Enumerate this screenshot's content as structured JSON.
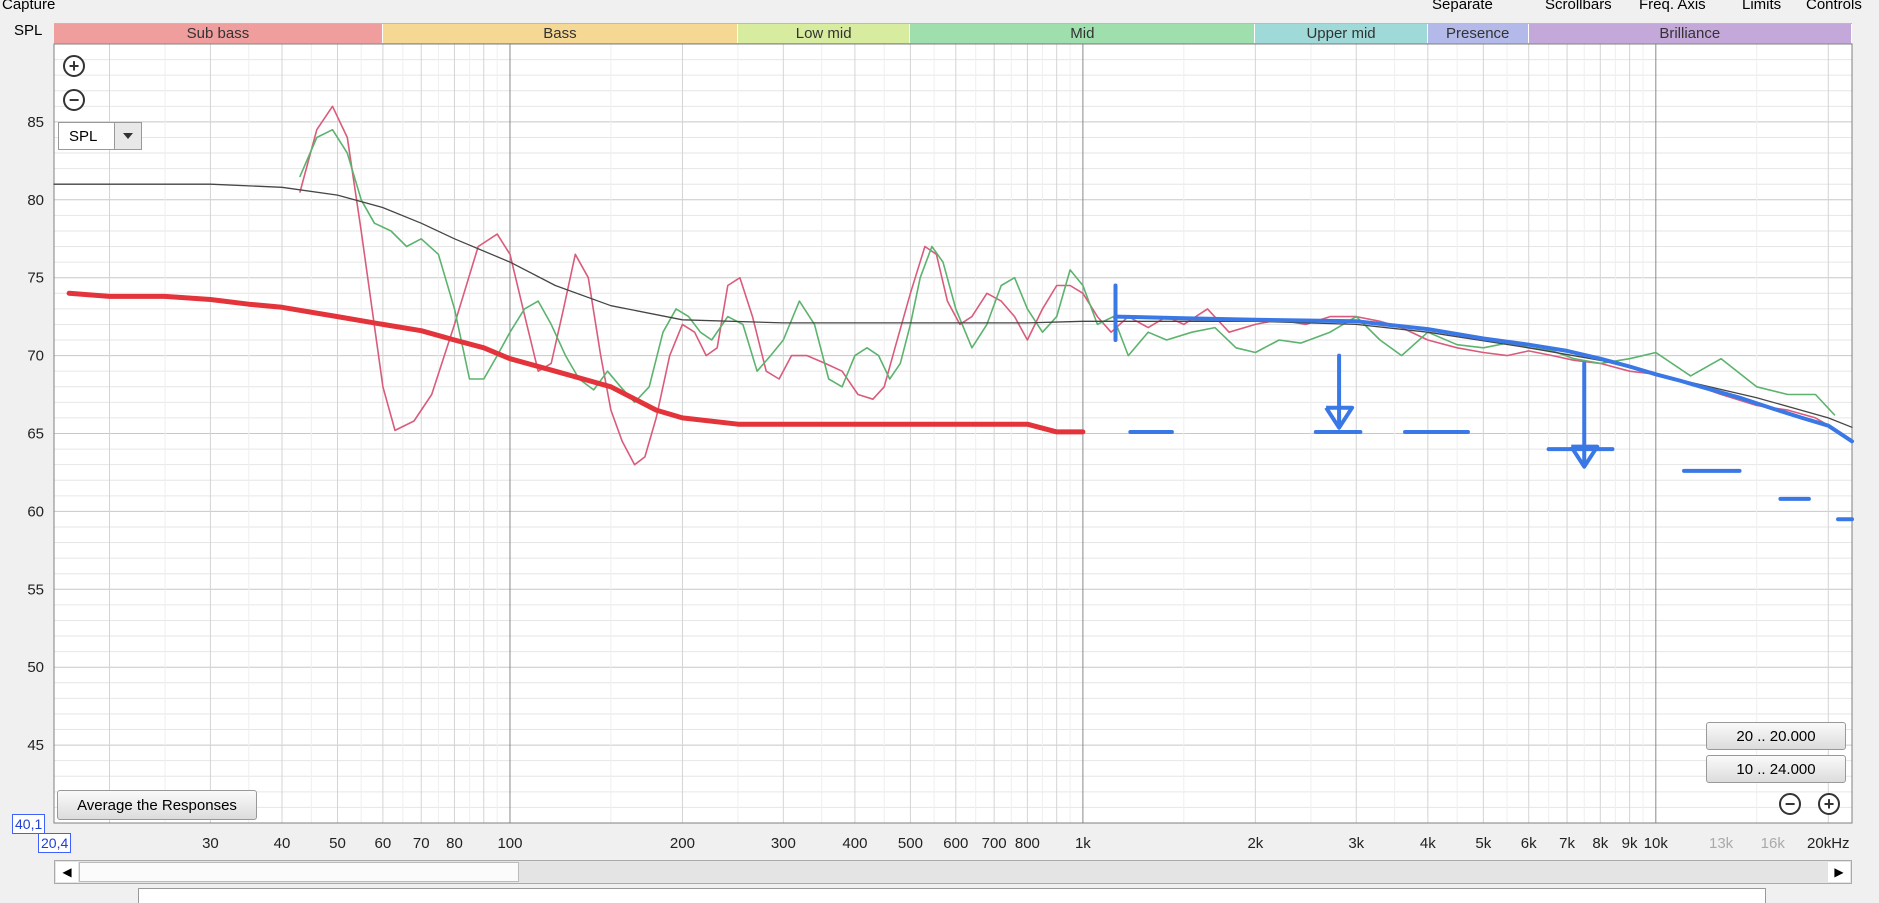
{
  "header": {
    "capture_label": "Capture",
    "spl_corner_label": "SPL",
    "menu": [
      "Separate",
      "Scrollbars",
      "Freq. Axis",
      "Limits",
      "Controls"
    ]
  },
  "bands": [
    {
      "label": "Sub bass",
      "from": 16,
      "to": 60,
      "color": "#ef9d9d"
    },
    {
      "label": "Bass",
      "from": 60,
      "to": 250,
      "color": "#f5d894"
    },
    {
      "label": "Low mid",
      "from": 250,
      "to": 500,
      "color": "#d8ec9f"
    },
    {
      "label": "Mid",
      "from": 500,
      "to": 2000,
      "color": "#9fdfae"
    },
    {
      "label": "Upper mid",
      "from": 2000,
      "to": 4000,
      "color": "#9fdad9"
    },
    {
      "label": "Presence",
      "from": 4000,
      "to": 6000,
      "color": "#b3b9e8"
    },
    {
      "label": "Brilliance",
      "from": 6000,
      "to": 22000,
      "color": "#c5a8da"
    }
  ],
  "controls": {
    "spl_select_value": "SPL",
    "average_button": "Average the Responses",
    "range_button_1": "20 .. 20.000",
    "range_button_2": "10 .. 24.000",
    "coord_y": "40,1",
    "coord_x": "20,4"
  },
  "chart_data": {
    "type": "line",
    "xscale": "log",
    "xlim": [
      16,
      22000
    ],
    "ylim": [
      40,
      90
    ],
    "ylabel": "SPL",
    "xunit": "kHz",
    "yticks": [
      45,
      50,
      55,
      60,
      65,
      70,
      75,
      80,
      85
    ],
    "xticks": [
      {
        "f": 30,
        "label": "30"
      },
      {
        "f": 40,
        "label": "40"
      },
      {
        "f": 50,
        "label": "50"
      },
      {
        "f": 60,
        "label": "60"
      },
      {
        "f": 70,
        "label": "70"
      },
      {
        "f": 80,
        "label": "80"
      },
      {
        "f": 100,
        "label": "100"
      },
      {
        "f": 200,
        "label": "200"
      },
      {
        "f": 300,
        "label": "300"
      },
      {
        "f": 400,
        "label": "400"
      },
      {
        "f": 500,
        "label": "500"
      },
      {
        "f": 600,
        "label": "600"
      },
      {
        "f": 700,
        "label": "700"
      },
      {
        "f": 800,
        "label": "800"
      },
      {
        "f": 1000,
        "label": "1k"
      },
      {
        "f": 2000,
        "label": "2k"
      },
      {
        "f": 3000,
        "label": "3k"
      },
      {
        "f": 4000,
        "label": "4k"
      },
      {
        "f": 5000,
        "label": "5k"
      },
      {
        "f": 6000,
        "label": "6k"
      },
      {
        "f": 7000,
        "label": "7k"
      },
      {
        "f": 8000,
        "label": "8k"
      },
      {
        "f": 9000,
        "label": "9k"
      },
      {
        "f": 10000,
        "label": "10k"
      },
      {
        "f": 13000,
        "label": "13k",
        "dim": true
      },
      {
        "f": 16000,
        "label": "16k",
        "dim": true
      },
      {
        "f": 20000,
        "label": "20kHz"
      }
    ],
    "series": [
      {
        "color": "#d95c7c",
        "x": [
          43,
          46,
          49,
          52,
          55,
          60,
          63,
          68,
          73,
          80,
          88,
          95,
          100,
          107,
          112,
          118,
          124,
          130,
          137,
          144,
          150,
          157,
          165,
          172,
          180,
          190,
          200,
          210,
          220,
          230,
          240,
          252,
          265,
          280,
          295,
          310,
          330,
          355,
          380,
          405,
          430,
          450,
          470,
          500,
          530,
          555,
          580,
          610,
          640,
          680,
          720,
          760,
          800,
          850,
          900,
          950,
          1000,
          1060,
          1120,
          1200,
          1300,
          1400,
          1500,
          1650,
          1800,
          2000,
          2200,
          2450,
          2700,
          3000,
          3300,
          3600,
          4000,
          4500,
          5000,
          5500,
          6000,
          6600,
          7200,
          8000,
          9000,
          10000,
          11500,
          13000,
          15000,
          17000,
          19000,
          20500
        ],
        "y": [
          80.5,
          84.5,
          86,
          84,
          78,
          68,
          65.2,
          65.8,
          67.5,
          72,
          77,
          77.8,
          76.5,
          72,
          69,
          69.5,
          73,
          76.5,
          75,
          70,
          66.5,
          64.5,
          63,
          63.5,
          66,
          70,
          72,
          71.5,
          70,
          70.5,
          74.5,
          75,
          72.5,
          69,
          68.5,
          70,
          70,
          69.5,
          69,
          67.5,
          67.2,
          68,
          70.5,
          74,
          77,
          76.5,
          73.5,
          72,
          72.5,
          74,
          73.5,
          72.5,
          71,
          73,
          74.5,
          74.5,
          74,
          72.5,
          71.5,
          72.5,
          71.8,
          72.5,
          72,
          73,
          71.5,
          72,
          72.3,
          72,
          72.5,
          72.5,
          72.2,
          71.8,
          71,
          70.5,
          70.2,
          70,
          70.3,
          70,
          69.7,
          69.5,
          69,
          68.8,
          68.2,
          67.5,
          66.8,
          66.5,
          66,
          65.3
        ]
      },
      {
        "color": "#5cb36e",
        "x": [
          43,
          46,
          49,
          52,
          55,
          58,
          62,
          66,
          70,
          75,
          80,
          85,
          90,
          95,
          100,
          106,
          112,
          118,
          125,
          132,
          140,
          148,
          156,
          165,
          175,
          185,
          195,
          205,
          215,
          225,
          240,
          255,
          270,
          285,
          300,
          320,
          340,
          360,
          380,
          400,
          420,
          440,
          460,
          480,
          500,
          520,
          545,
          570,
          600,
          640,
          680,
          720,
          760,
          800,
          850,
          900,
          950,
          1000,
          1060,
          1130,
          1200,
          1300,
          1400,
          1550,
          1700,
          1850,
          2000,
          2200,
          2400,
          2700,
          3000,
          3300,
          3600,
          4000,
          4500,
          5000,
          5500,
          6000,
          6600,
          7200,
          8000,
          9000,
          10000,
          11500,
          13000,
          15000,
          17000,
          19000,
          20500
        ],
        "y": [
          81.5,
          84,
          84.5,
          83,
          80,
          78.5,
          78,
          77,
          77.5,
          76.5,
          73,
          68.5,
          68.5,
          70,
          71.5,
          73,
          73.5,
          72,
          70,
          68.5,
          67.8,
          69,
          68,
          67,
          68,
          71.5,
          73,
          72.5,
          71.5,
          71,
          72.5,
          72,
          69,
          70,
          71,
          73.5,
          72,
          68.5,
          68,
          70,
          70.5,
          70,
          68.5,
          69.5,
          72,
          75,
          77,
          76,
          73,
          70.5,
          72,
          74.5,
          75,
          73,
          71.5,
          72.5,
          75.5,
          74.5,
          72,
          72.5,
          70,
          71.5,
          71,
          71.5,
          71.8,
          70.5,
          70.2,
          71,
          70.8,
          71.5,
          72.5,
          71,
          70,
          71.5,
          70.7,
          70.5,
          70.8,
          70.5,
          70.3,
          69.8,
          69.5,
          69.8,
          70.2,
          68.7,
          69.8,
          68,
          67.5,
          67.5,
          66.2
        ]
      },
      {
        "color": "#454545",
        "x": [
          16,
          30,
          40,
          50,
          60,
          70,
          80,
          100,
          120,
          150,
          200,
          300,
          500,
          800,
          1000,
          1500,
          2000,
          3000,
          4000,
          6000,
          8000,
          10000,
          15000,
          20000,
          22000
        ],
        "y": [
          81,
          81,
          80.8,
          80.3,
          79.5,
          78.5,
          77.5,
          76,
          74.5,
          73.2,
          72.3,
          72.1,
          72.1,
          72.1,
          72.2,
          72.2,
          72.2,
          72,
          71.5,
          70.5,
          69.7,
          68.8,
          67.3,
          66,
          65.4
        ]
      },
      {
        "color": "#e3343c",
        "x": [
          17,
          20,
          25,
          30,
          35,
          40,
          50,
          60,
          70,
          80,
          90,
          100,
          120,
          150,
          180,
          200,
          250,
          300,
          400,
          600,
          800,
          900,
          1000
        ],
        "y": [
          74,
          73.8,
          73.8,
          73.6,
          73.3,
          73.1,
          72.5,
          72,
          71.6,
          71,
          70.5,
          69.8,
          69,
          68,
          66.5,
          66,
          65.6,
          65.6,
          65.6,
          65.6,
          65.6,
          65.1,
          65.1
        ]
      }
    ],
    "annotations": {
      "color": "#3a78e6",
      "target_line": {
        "x": [
          1140,
          1500,
          2000,
          3000,
          4000,
          5000,
          6000,
          7000,
          8000,
          9000,
          10000,
          11000,
          12000,
          14000,
          16000,
          18000,
          20000,
          22000
        ],
        "y": [
          72.5,
          72.4,
          72.3,
          72.2,
          71.7,
          71.1,
          70.7,
          70.3,
          69.8,
          69.3,
          68.8,
          68.4,
          68,
          67.3,
          66.6,
          66,
          65.5,
          64.5
        ]
      },
      "target_start_tick": {
        "x": 1140,
        "y1": 74.5,
        "y2": 71
      },
      "down_arrows": [
        {
          "x": 2800,
          "from": 70,
          "to": 65.5
        },
        {
          "x": 7500,
          "from": 69.5,
          "to": 63
        }
      ],
      "dashes": [
        {
          "x1": 1210,
          "x2": 1430,
          "y": 65.1
        },
        {
          "x1": 2550,
          "x2": 3050,
          "y": 65.1
        },
        {
          "x1": 3650,
          "x2": 4700,
          "y": 65.1
        },
        {
          "x1": 6500,
          "x2": 8400,
          "y": 64
        },
        {
          "x1": 11200,
          "x2": 14000,
          "y": 62.6
        },
        {
          "x1": 16500,
          "x2": 18500,
          "y": 60.8
        },
        {
          "x1": 20800,
          "x2": 22000,
          "y": 59.5
        }
      ]
    }
  }
}
